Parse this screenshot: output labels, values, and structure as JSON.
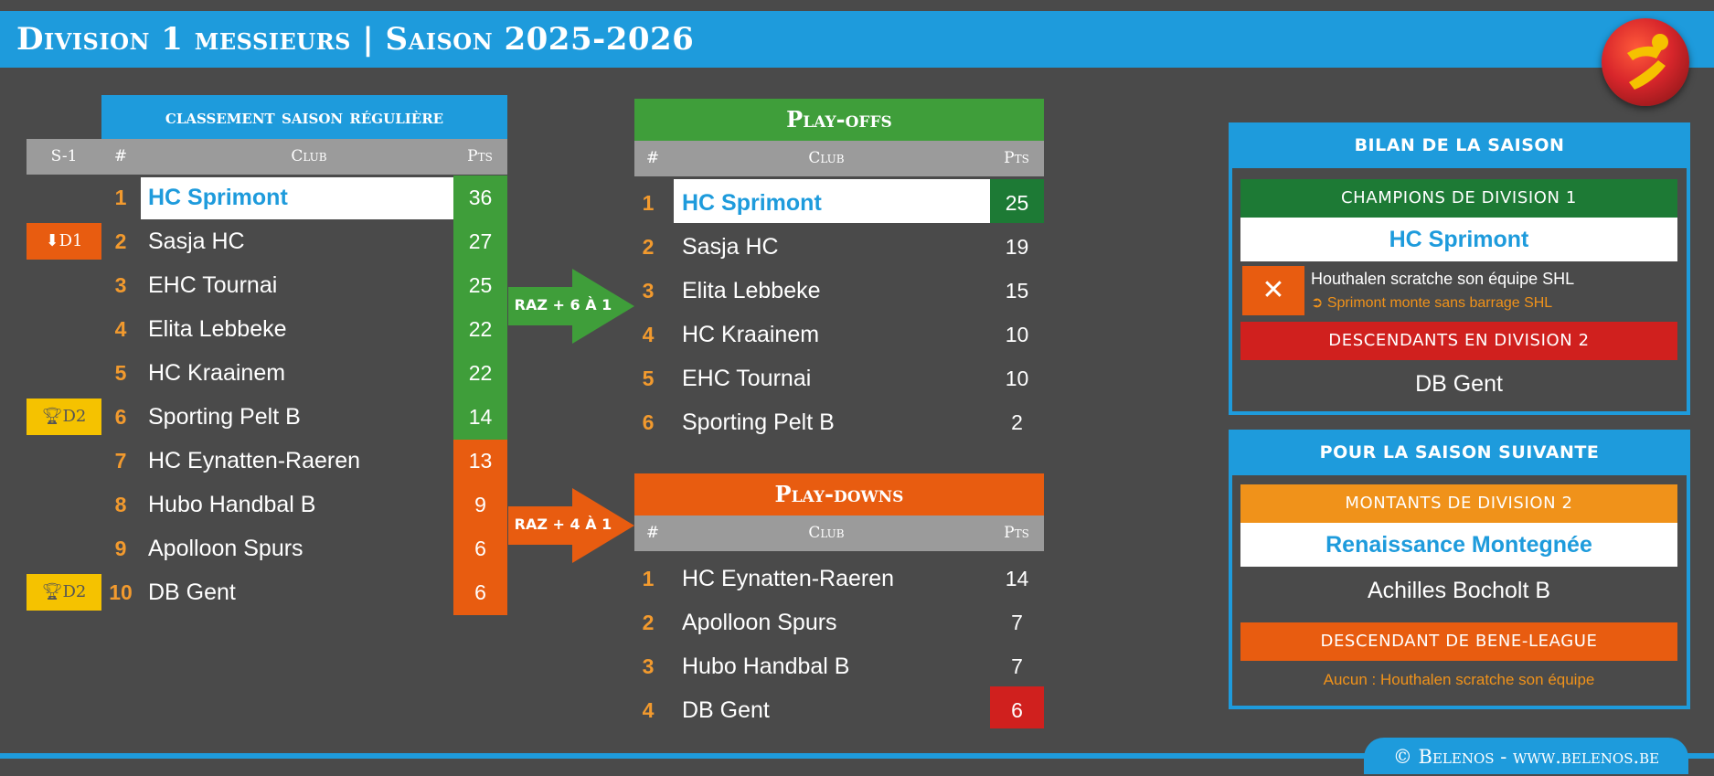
{
  "header": {
    "title": "Division 1 messieurs | Saison 2025-2026",
    "logo_icon": "belenos-ball-logo"
  },
  "colors": {
    "blue": "#1e9bdc",
    "green": "#3f9e3a",
    "darkgreen": "#1d7a35",
    "orange": "#e85c10",
    "amber": "#f0921a",
    "red": "#d0201e",
    "yellow": "#f5c200",
    "grey": "#9b9b9b",
    "background": "#4a4a4a"
  },
  "regular": {
    "title": "classement saison régulière",
    "col_prev": "S-1",
    "col_rank": "#",
    "col_club": "Club",
    "col_pts": "Pts",
    "rows": [
      {
        "rank": "1",
        "club": "HC Sprimont",
        "pts": "36",
        "badge": ""
      },
      {
        "rank": "2",
        "club": "Sasja HC",
        "pts": "27",
        "badge": "D1",
        "badge_icon": "arrow-down-icon"
      },
      {
        "rank": "3",
        "club": "EHC Tournai",
        "pts": "25",
        "badge": ""
      },
      {
        "rank": "4",
        "club": "Elita Lebbeke",
        "pts": "22",
        "badge": ""
      },
      {
        "rank": "5",
        "club": "HC Kraainem",
        "pts": "22",
        "badge": ""
      },
      {
        "rank": "6",
        "club": "Sporting Pelt B",
        "pts": "14",
        "badge": "D2",
        "badge_icon": "trophy-icon"
      },
      {
        "rank": "7",
        "club": "HC Eynatten-Raeren",
        "pts": "13",
        "badge": ""
      },
      {
        "rank": "8",
        "club": "Hubo Handbal B",
        "pts": "9",
        "badge": ""
      },
      {
        "rank": "9",
        "club": "Apolloon Spurs",
        "pts": "6",
        "badge": ""
      },
      {
        "rank": "10",
        "club": "DB Gent",
        "pts": "6",
        "badge": "D2",
        "badge_icon": "trophy-icon"
      }
    ]
  },
  "arrows": {
    "playoffs_label": "RAZ + 6 À 1",
    "playdowns_label": "RAZ + 4 À 1"
  },
  "playoffs": {
    "title": "Play-offs",
    "col_rank": "#",
    "col_club": "Club",
    "col_pts": "Pts",
    "rows": [
      {
        "rank": "1",
        "club": "HC Sprimont",
        "pts": "25"
      },
      {
        "rank": "2",
        "club": "Sasja HC",
        "pts": "19"
      },
      {
        "rank": "3",
        "club": "Elita Lebbeke",
        "pts": "15"
      },
      {
        "rank": "4",
        "club": "HC Kraainem",
        "pts": "10"
      },
      {
        "rank": "5",
        "club": "EHC Tournai",
        "pts": "10"
      },
      {
        "rank": "6",
        "club": "Sporting Pelt B",
        "pts": "2"
      }
    ]
  },
  "playdowns": {
    "title": "Play-downs",
    "col_rank": "#",
    "col_club": "Club",
    "col_pts": "Pts",
    "rows": [
      {
        "rank": "1",
        "club": "HC Eynatten-Raeren",
        "pts": "14"
      },
      {
        "rank": "2",
        "club": "Apolloon Spurs",
        "pts": "7"
      },
      {
        "rank": "3",
        "club": "Hubo Handbal B",
        "pts": "7"
      },
      {
        "rank": "4",
        "club": "DB Gent",
        "pts": "6"
      }
    ]
  },
  "bilan": {
    "title": "BILAN DE LA SAISON",
    "champions_label": "CHAMPIONS DE DIVISION 1",
    "champion": "HC Sprimont",
    "notice_line1": "Houthalen scratche son équipe SHL",
    "notice_line2": "Sprimont monte sans barrage SHL",
    "notice_icon": "close-icon",
    "notice_sub_icon": "redo-arrow-icon",
    "relegated_label": "DESCENDANTS EN DIVISION 2",
    "relegated": "DB Gent"
  },
  "next": {
    "title": "POUR LA SAISON SUIVANTE",
    "promoted_label": "MONTANTS DE DIVISION 2",
    "promoted_1": "Renaissance Montegnée",
    "promoted_2": "Achilles Bocholt B",
    "down_label": "DESCENDANT DE BENE-LEAGUE",
    "down_value": "Aucun : Houthalen scratche son équipe"
  },
  "footer": {
    "copyright": "© Belenos - www.belenos.be"
  }
}
